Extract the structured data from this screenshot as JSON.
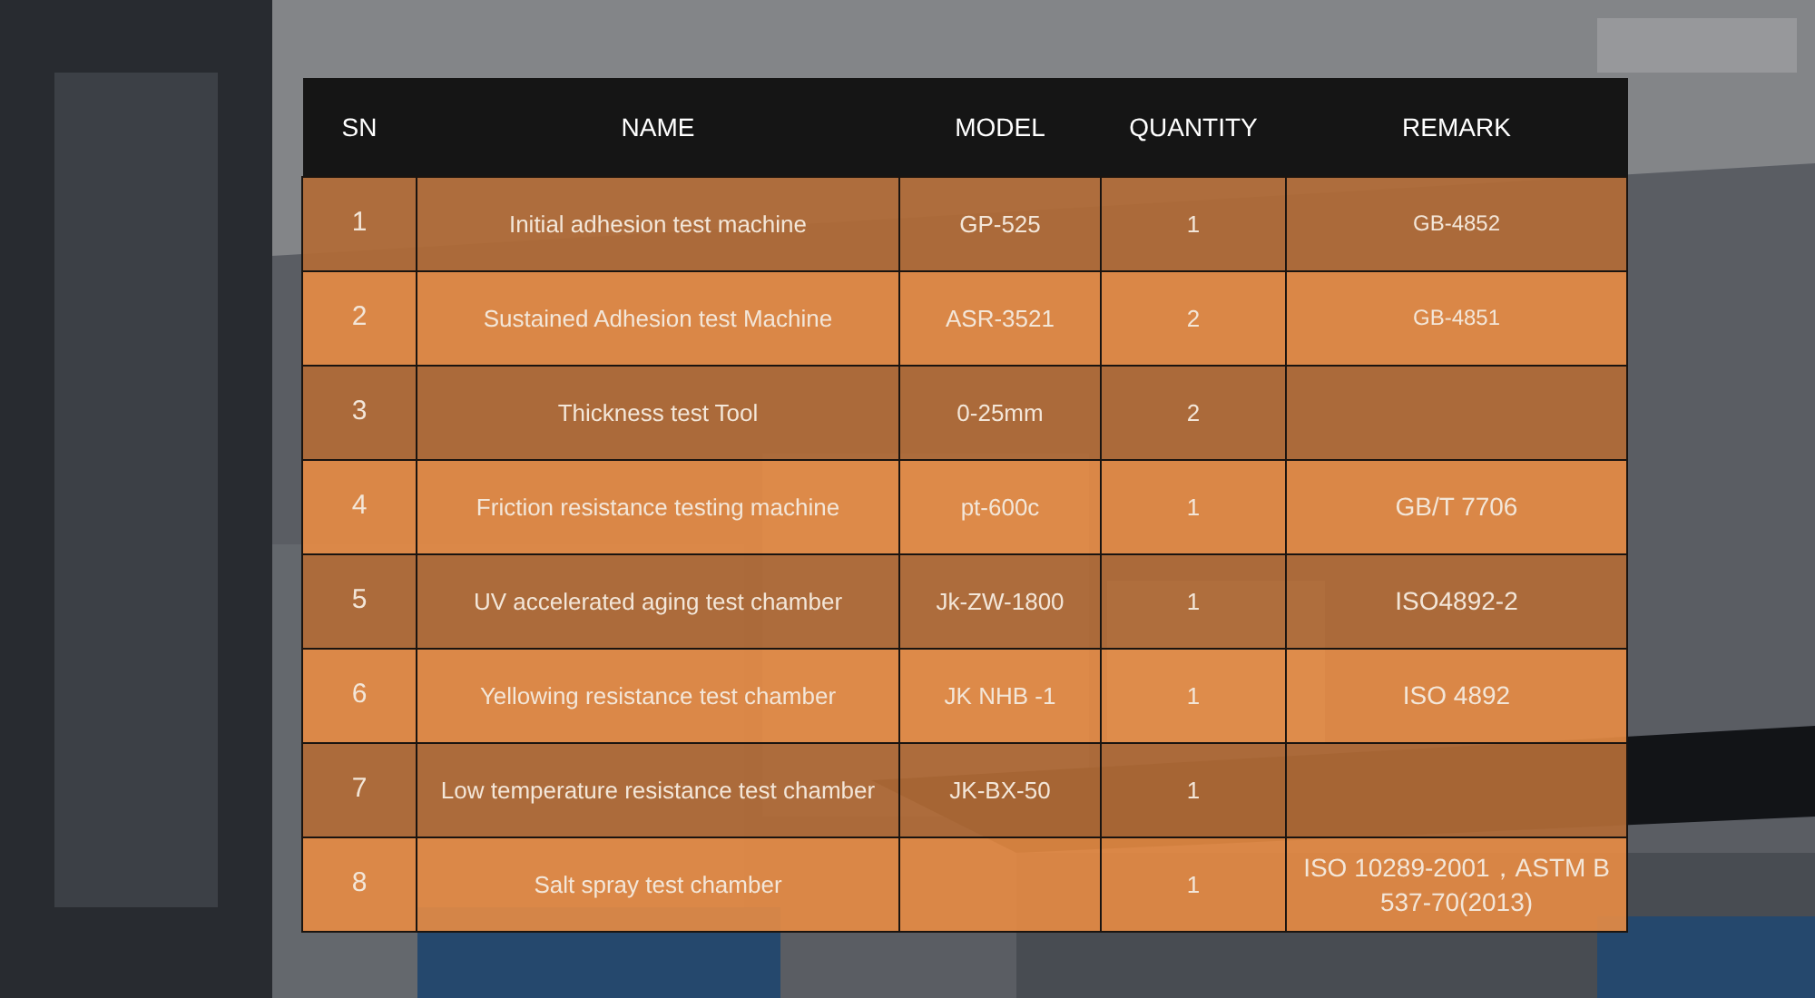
{
  "table": {
    "columns": [
      "SN",
      "NAME",
      "MODEL",
      "QUANTITY",
      "REMARK"
    ],
    "rows": [
      {
        "sn": "1",
        "name": "Initial adhesion test machine",
        "model": "GP-525",
        "quantity": "1",
        "remark": "GB-4852"
      },
      {
        "sn": "2",
        "name": "Sustained Adhesion test Machine",
        "model": "ASR-3521",
        "quantity": "2",
        "remark": "GB-4851"
      },
      {
        "sn": "3",
        "name": "Thickness test Tool",
        "model": "0-25mm",
        "quantity": "2"
      },
      {
        "sn": "4",
        "name": "Friction resistance testing machine",
        "model": "pt-600c",
        "quantity": "1",
        "remark": "GB/T 7706"
      },
      {
        "sn": "5",
        "name": "UV accelerated aging test chamber",
        "model": "Jk-ZW-1800",
        "quantity": "1",
        "remark": "ISO4892-2"
      },
      {
        "sn": "6",
        "name": "Yellowing resistance test chamber",
        "model": "JK NHB -1",
        "quantity": "1",
        "remark": "ISO 4892"
      },
      {
        "sn": "7",
        "name": "Low temperature resistance test chamber",
        "model": "JK-BX-50",
        "quantity": "1"
      },
      {
        "sn": "8",
        "name": "Salt spray test chamber",
        "quantity": "1",
        "remark": "ISO 10289-2001，ASTM B 537-70(2013)"
      }
    ]
  }
}
